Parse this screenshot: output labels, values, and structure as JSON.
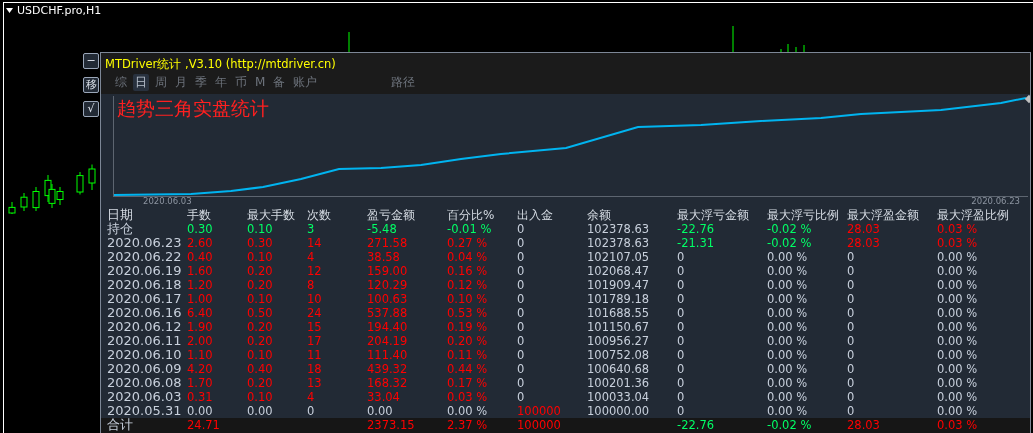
{
  "chart_window": {
    "title": "USDCHF.pro,H1"
  },
  "side_buttons": [
    "−",
    "移",
    "√"
  ],
  "panel": {
    "title": "MTDriver统计 ,V3.10 (http://mtdriver.cn)",
    "tabs": [
      {
        "label": "综",
        "selected": false
      },
      {
        "label": "日",
        "selected": true
      },
      {
        "label": "周",
        "selected": false
      },
      {
        "label": "月",
        "selected": false
      },
      {
        "label": "季",
        "selected": false
      },
      {
        "label": "年",
        "selected": false
      },
      {
        "label": "币",
        "selected": false
      },
      {
        "label": "M",
        "selected": false
      },
      {
        "label": "备",
        "selected": false
      },
      {
        "label": "账户",
        "selected": false
      },
      {
        "label": "路径",
        "selected": false
      }
    ],
    "heading": "趋势三角实盘统计",
    "equity_curve": {
      "x_labels": [
        "2020.06.03",
        "2020.06.23"
      ]
    },
    "table": {
      "columns": [
        "日期",
        "手数",
        "最大手数",
        "次数",
        "盈亏金额",
        "百分比%",
        "出入金",
        "余额",
        "最大浮亏金额",
        "最大浮亏比例",
        "最大浮盈金额",
        "最大浮盈比例"
      ],
      "rows": [
        {
          "cells": [
            {
              "text": "持仓",
              "color": "#c8d0dc"
            },
            {
              "text": "0.30",
              "color": "#00ff66"
            },
            {
              "text": "0.10",
              "color": "#00ff66"
            },
            {
              "text": "3",
              "color": "#00ff66"
            },
            {
              "text": "-5.48",
              "color": "#00ff66"
            },
            {
              "text": "-0.01 %",
              "color": "#00ff66"
            },
            {
              "text": "0",
              "color": "#c8d0dc"
            },
            {
              "text": "102378.63",
              "color": "#c8d0dc"
            },
            {
              "text": "-22.76",
              "color": "#00ff66"
            },
            {
              "text": "-0.02 %",
              "color": "#00ff66"
            },
            {
              "text": "28.03",
              "color": "#ff0000"
            },
            {
              "text": "0.03 %",
              "color": "#ff0000"
            }
          ]
        },
        {
          "cells": [
            {
              "text": "2020.06.23",
              "color": "#c8d0dc"
            },
            {
              "text": "2.60",
              "color": "#ff0000"
            },
            {
              "text": "0.30",
              "color": "#ff0000"
            },
            {
              "text": "14",
              "color": "#ff0000"
            },
            {
              "text": "271.58",
              "color": "#ff0000"
            },
            {
              "text": "0.27 %",
              "color": "#ff0000"
            },
            {
              "text": "0",
              "color": "#c8d0dc"
            },
            {
              "text": "102378.63",
              "color": "#c8d0dc"
            },
            {
              "text": "-21.31",
              "color": "#00ff66"
            },
            {
              "text": "-0.02 %",
              "color": "#00ff66"
            },
            {
              "text": "28.03",
              "color": "#ff0000"
            },
            {
              "text": "0.03 %",
              "color": "#ff0000"
            }
          ]
        },
        {
          "cells": [
            {
              "text": "2020.06.22",
              "color": "#c8d0dc"
            },
            {
              "text": "0.40",
              "color": "#ff0000"
            },
            {
              "text": "0.10",
              "color": "#ff0000"
            },
            {
              "text": "4",
              "color": "#ff0000"
            },
            {
              "text": "38.58",
              "color": "#ff0000"
            },
            {
              "text": "0.04 %",
              "color": "#ff0000"
            },
            {
              "text": "0",
              "color": "#c8d0dc"
            },
            {
              "text": "102107.05",
              "color": "#c8d0dc"
            },
            {
              "text": "0",
              "color": "#c8d0dc"
            },
            {
              "text": "0.00 %",
              "color": "#c8d0dc"
            },
            {
              "text": "0",
              "color": "#c8d0dc"
            },
            {
              "text": "0.00 %",
              "color": "#c8d0dc"
            }
          ]
        },
        {
          "cells": [
            {
              "text": "2020.06.19",
              "color": "#c8d0dc"
            },
            {
              "text": "1.60",
              "color": "#ff0000"
            },
            {
              "text": "0.20",
              "color": "#ff0000"
            },
            {
              "text": "12",
              "color": "#ff0000"
            },
            {
              "text": "159.00",
              "color": "#ff0000"
            },
            {
              "text": "0.16 %",
              "color": "#ff0000"
            },
            {
              "text": "0",
              "color": "#c8d0dc"
            },
            {
              "text": "102068.47",
              "color": "#c8d0dc"
            },
            {
              "text": "0",
              "color": "#c8d0dc"
            },
            {
              "text": "0.00 %",
              "color": "#c8d0dc"
            },
            {
              "text": "0",
              "color": "#c8d0dc"
            },
            {
              "text": "0.00 %",
              "color": "#c8d0dc"
            }
          ]
        },
        {
          "cells": [
            {
              "text": "2020.06.18",
              "color": "#c8d0dc"
            },
            {
              "text": "1.20",
              "color": "#ff0000"
            },
            {
              "text": "0.20",
              "color": "#ff0000"
            },
            {
              "text": "8",
              "color": "#ff0000"
            },
            {
              "text": "120.29",
              "color": "#ff0000"
            },
            {
              "text": "0.12 %",
              "color": "#ff0000"
            },
            {
              "text": "0",
              "color": "#c8d0dc"
            },
            {
              "text": "101909.47",
              "color": "#c8d0dc"
            },
            {
              "text": "0",
              "color": "#c8d0dc"
            },
            {
              "text": "0.00 %",
              "color": "#c8d0dc"
            },
            {
              "text": "0",
              "color": "#c8d0dc"
            },
            {
              "text": "0.00 %",
              "color": "#c8d0dc"
            }
          ]
        },
        {
          "cells": [
            {
              "text": "2020.06.17",
              "color": "#c8d0dc"
            },
            {
              "text": "1.00",
              "color": "#ff0000"
            },
            {
              "text": "0.10",
              "color": "#ff0000"
            },
            {
              "text": "10",
              "color": "#ff0000"
            },
            {
              "text": "100.63",
              "color": "#ff0000"
            },
            {
              "text": "0.10 %",
              "color": "#ff0000"
            },
            {
              "text": "0",
              "color": "#c8d0dc"
            },
            {
              "text": "101789.18",
              "color": "#c8d0dc"
            },
            {
              "text": "0",
              "color": "#c8d0dc"
            },
            {
              "text": "0.00 %",
              "color": "#c8d0dc"
            },
            {
              "text": "0",
              "color": "#c8d0dc"
            },
            {
              "text": "0.00 %",
              "color": "#c8d0dc"
            }
          ]
        },
        {
          "cells": [
            {
              "text": "2020.06.16",
              "color": "#c8d0dc"
            },
            {
              "text": "6.40",
              "color": "#ff0000"
            },
            {
              "text": "0.50",
              "color": "#ff0000"
            },
            {
              "text": "24",
              "color": "#ff0000"
            },
            {
              "text": "537.88",
              "color": "#ff0000"
            },
            {
              "text": "0.53 %",
              "color": "#ff0000"
            },
            {
              "text": "0",
              "color": "#c8d0dc"
            },
            {
              "text": "101688.55",
              "color": "#c8d0dc"
            },
            {
              "text": "0",
              "color": "#c8d0dc"
            },
            {
              "text": "0.00 %",
              "color": "#c8d0dc"
            },
            {
              "text": "0",
              "color": "#c8d0dc"
            },
            {
              "text": "0.00 %",
              "color": "#c8d0dc"
            }
          ]
        },
        {
          "cells": [
            {
              "text": "2020.06.12",
              "color": "#c8d0dc"
            },
            {
              "text": "1.90",
              "color": "#ff0000"
            },
            {
              "text": "0.20",
              "color": "#ff0000"
            },
            {
              "text": "15",
              "color": "#ff0000"
            },
            {
              "text": "194.40",
              "color": "#ff0000"
            },
            {
              "text": "0.19 %",
              "color": "#ff0000"
            },
            {
              "text": "0",
              "color": "#c8d0dc"
            },
            {
              "text": "101150.67",
              "color": "#c8d0dc"
            },
            {
              "text": "0",
              "color": "#c8d0dc"
            },
            {
              "text": "0.00 %",
              "color": "#c8d0dc"
            },
            {
              "text": "0",
              "color": "#c8d0dc"
            },
            {
              "text": "0.00 %",
              "color": "#c8d0dc"
            }
          ]
        },
        {
          "cells": [
            {
              "text": "2020.06.11",
              "color": "#c8d0dc"
            },
            {
              "text": "2.00",
              "color": "#ff0000"
            },
            {
              "text": "0.20",
              "color": "#ff0000"
            },
            {
              "text": "17",
              "color": "#ff0000"
            },
            {
              "text": "204.19",
              "color": "#ff0000"
            },
            {
              "text": "0.20 %",
              "color": "#ff0000"
            },
            {
              "text": "0",
              "color": "#c8d0dc"
            },
            {
              "text": "100956.27",
              "color": "#c8d0dc"
            },
            {
              "text": "0",
              "color": "#c8d0dc"
            },
            {
              "text": "0.00 %",
              "color": "#c8d0dc"
            },
            {
              "text": "0",
              "color": "#c8d0dc"
            },
            {
              "text": "0.00 %",
              "color": "#c8d0dc"
            }
          ]
        },
        {
          "cells": [
            {
              "text": "2020.06.10",
              "color": "#c8d0dc"
            },
            {
              "text": "1.10",
              "color": "#ff0000"
            },
            {
              "text": "0.10",
              "color": "#ff0000"
            },
            {
              "text": "11",
              "color": "#ff0000"
            },
            {
              "text": "111.40",
              "color": "#ff0000"
            },
            {
              "text": "0.11 %",
              "color": "#ff0000"
            },
            {
              "text": "0",
              "color": "#c8d0dc"
            },
            {
              "text": "100752.08",
              "color": "#c8d0dc"
            },
            {
              "text": "0",
              "color": "#c8d0dc"
            },
            {
              "text": "0.00 %",
              "color": "#c8d0dc"
            },
            {
              "text": "0",
              "color": "#c8d0dc"
            },
            {
              "text": "0.00 %",
              "color": "#c8d0dc"
            }
          ]
        },
        {
          "cells": [
            {
              "text": "2020.06.09",
              "color": "#c8d0dc"
            },
            {
              "text": "4.20",
              "color": "#ff0000"
            },
            {
              "text": "0.40",
              "color": "#ff0000"
            },
            {
              "text": "18",
              "color": "#ff0000"
            },
            {
              "text": "439.32",
              "color": "#ff0000"
            },
            {
              "text": "0.44 %",
              "color": "#ff0000"
            },
            {
              "text": "0",
              "color": "#c8d0dc"
            },
            {
              "text": "100640.68",
              "color": "#c8d0dc"
            },
            {
              "text": "0",
              "color": "#c8d0dc"
            },
            {
              "text": "0.00 %",
              "color": "#c8d0dc"
            },
            {
              "text": "0",
              "color": "#c8d0dc"
            },
            {
              "text": "0.00 %",
              "color": "#c8d0dc"
            }
          ]
        },
        {
          "cells": [
            {
              "text": "2020.06.08",
              "color": "#c8d0dc"
            },
            {
              "text": "1.70",
              "color": "#ff0000"
            },
            {
              "text": "0.20",
              "color": "#ff0000"
            },
            {
              "text": "13",
              "color": "#ff0000"
            },
            {
              "text": "168.32",
              "color": "#ff0000"
            },
            {
              "text": "0.17 %",
              "color": "#ff0000"
            },
            {
              "text": "0",
              "color": "#c8d0dc"
            },
            {
              "text": "100201.36",
              "color": "#c8d0dc"
            },
            {
              "text": "0",
              "color": "#c8d0dc"
            },
            {
              "text": "0.00 %",
              "color": "#c8d0dc"
            },
            {
              "text": "0",
              "color": "#c8d0dc"
            },
            {
              "text": "0.00 %",
              "color": "#c8d0dc"
            }
          ]
        },
        {
          "cells": [
            {
              "text": "2020.06.03",
              "color": "#c8d0dc"
            },
            {
              "text": "0.31",
              "color": "#ff0000"
            },
            {
              "text": "0.10",
              "color": "#ff0000"
            },
            {
              "text": "4",
              "color": "#ff0000"
            },
            {
              "text": "33.04",
              "color": "#ff0000"
            },
            {
              "text": "0.03 %",
              "color": "#ff0000"
            },
            {
              "text": "0",
              "color": "#c8d0dc"
            },
            {
              "text": "100033.04",
              "color": "#c8d0dc"
            },
            {
              "text": "0",
              "color": "#c8d0dc"
            },
            {
              "text": "0.00 %",
              "color": "#c8d0dc"
            },
            {
              "text": "0",
              "color": "#c8d0dc"
            },
            {
              "text": "0.00 %",
              "color": "#c8d0dc"
            }
          ]
        },
        {
          "cells": [
            {
              "text": "2020.05.31",
              "color": "#c8d0dc"
            },
            {
              "text": "0.00",
              "color": "#c8d0dc"
            },
            {
              "text": "0.00",
              "color": "#c8d0dc"
            },
            {
              "text": "0",
              "color": "#c8d0dc"
            },
            {
              "text": "0.00",
              "color": "#c8d0dc"
            },
            {
              "text": "0.00 %",
              "color": "#c8d0dc"
            },
            {
              "text": "100000",
              "color": "#ff0000"
            },
            {
              "text": "100000.00",
              "color": "#c8d0dc"
            },
            {
              "text": "0",
              "color": "#c8d0dc"
            },
            {
              "text": "0.00 %",
              "color": "#c8d0dc"
            },
            {
              "text": "0",
              "color": "#c8d0dc"
            },
            {
              "text": "0.00 %",
              "color": "#c8d0dc"
            }
          ]
        }
      ],
      "total": {
        "cells": [
          {
            "text": "合计",
            "color": "#c8d0dc"
          },
          {
            "text": "24.71",
            "color": "#ff0000"
          },
          null,
          null,
          {
            "text": "2373.15",
            "color": "#ff0000"
          },
          {
            "text": "2.37 %",
            "color": "#ff0000"
          },
          {
            "text": "100000",
            "color": "#ff0000"
          },
          null,
          {
            "text": "-22.76",
            "color": "#00ff66"
          },
          {
            "text": "-0.02 %",
            "color": "#00ff66"
          },
          {
            "text": "28.03",
            "color": "#ff0000"
          },
          {
            "text": "0.03 %",
            "color": "#ff0000"
          }
        ]
      }
    }
  }
}
